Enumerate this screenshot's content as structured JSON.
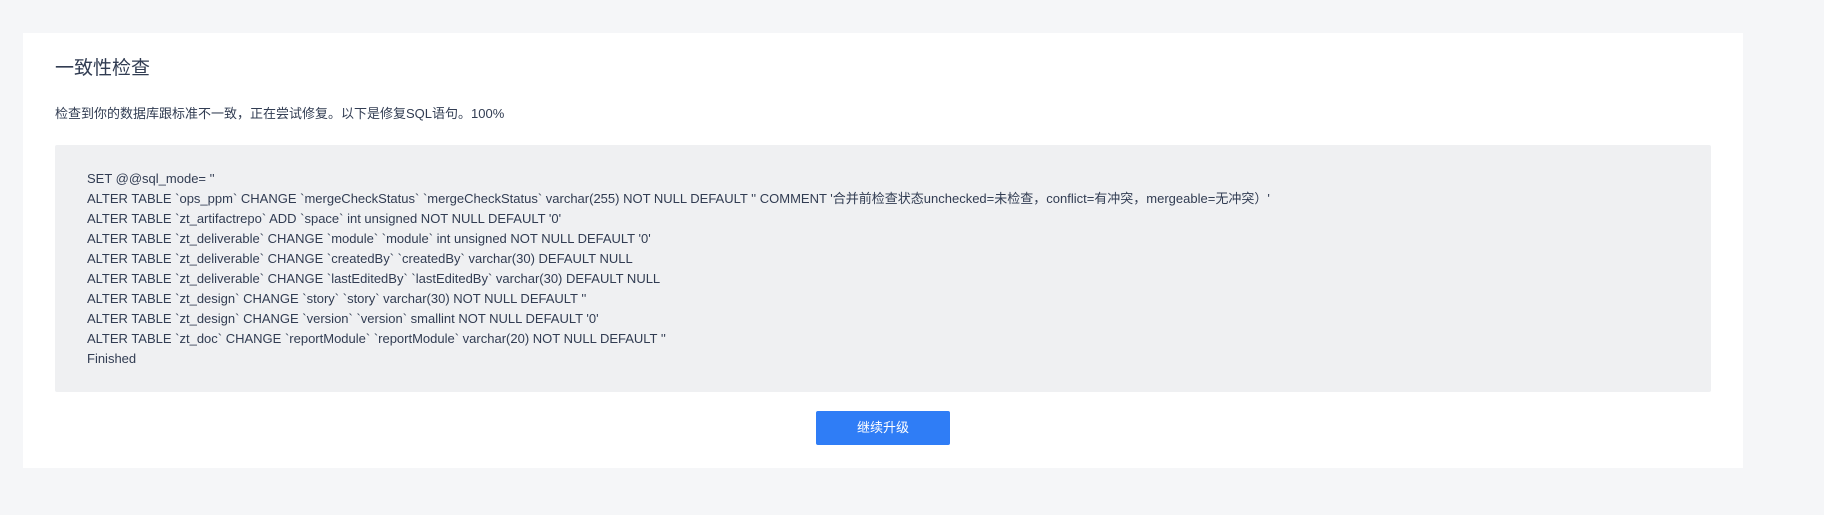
{
  "page": {
    "title": "一致性检查",
    "message": "检查到你的数据库跟标准不一致，正在尝试修复。以下是修复SQL语句。100%"
  },
  "sql": {
    "lines": [
      "SET @@sql_mode= ''",
      "ALTER TABLE `ops_ppm` CHANGE `mergeCheckStatus` `mergeCheckStatus` varchar(255) NOT NULL DEFAULT '' COMMENT '合并前检查状态unchecked=未检查，conflict=有冲突，mergeable=无冲突）'",
      "ALTER TABLE `zt_artifactrepo` ADD `space` int unsigned NOT NULL DEFAULT '0'",
      "ALTER TABLE `zt_deliverable` CHANGE `module` `module` int unsigned NOT NULL DEFAULT '0'",
      "ALTER TABLE `zt_deliverable` CHANGE `createdBy` `createdBy` varchar(30) DEFAULT NULL",
      "ALTER TABLE `zt_deliverable` CHANGE `lastEditedBy` `lastEditedBy` varchar(30) DEFAULT NULL",
      "ALTER TABLE `zt_design` CHANGE `story` `story` varchar(30) NOT NULL DEFAULT ''",
      "ALTER TABLE `zt_design` CHANGE `version` `version` smallint NOT NULL DEFAULT '0'",
      "ALTER TABLE `zt_doc` CHANGE `reportModule` `reportModule` varchar(20) NOT NULL DEFAULT ''",
      "Finished"
    ]
  },
  "actions": {
    "continue_label": "继续升级"
  },
  "colors": {
    "page_background": "#f5f6f8",
    "card_background": "#ffffff",
    "sql_background": "#eff0f2",
    "primary_button": "#2f7df6",
    "text": "#313c52"
  }
}
